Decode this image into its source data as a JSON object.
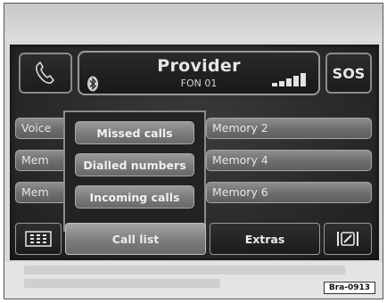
{
  "header": {
    "provider_title": "Provider",
    "provider_subtitle": "FON 01",
    "sos_label": "SOS",
    "signal_bars": 5
  },
  "memory_buttons": [
    {
      "label": "Voice"
    },
    {
      "label": "Memory 2"
    },
    {
      "label": "Mem"
    },
    {
      "label": "Memory 4"
    },
    {
      "label": "Mem"
    },
    {
      "label": "Memory 6"
    }
  ],
  "popup_menu": {
    "items": [
      "Missed calls",
      "Dialled numbers",
      "Incoming calls"
    ]
  },
  "bottom_bar": {
    "call_list_label": "Call list",
    "extras_label": "Extras"
  },
  "reference_label": "Bra-0913",
  "colors": {
    "screen_background": "#262626",
    "button_gray": "#7a7a7a",
    "text_light": "#e6e6e6"
  }
}
